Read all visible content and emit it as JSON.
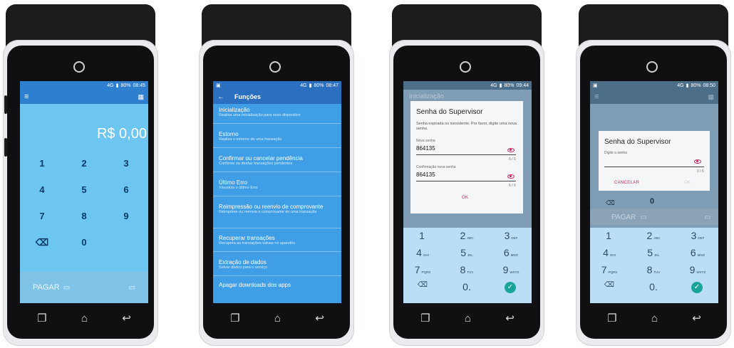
{
  "devices": [
    {
      "status": {
        "network": "4G",
        "battery": "80%",
        "time": "08:45"
      },
      "screen": {
        "amount": "R$ 0,00",
        "keys": [
          "1",
          "2",
          "3",
          "4",
          "5",
          "6",
          "7",
          "8",
          "9",
          "0"
        ],
        "pay_label": "PAGAR"
      }
    },
    {
      "status": {
        "network": "4G",
        "battery": "80%",
        "time": "08:47"
      },
      "screen": {
        "title": "Funções",
        "menu": [
          {
            "title": "Inicialização",
            "desc": "Realiza uma inicialização para esse dispositivo"
          },
          {
            "title": "Estorno",
            "desc": "Realiza o estorno de uma transação"
          },
          {
            "title": "Confirmar ou cancelar pendência",
            "desc": "Confirme ou desfaz transações pendentes"
          },
          {
            "title": "Último Erro",
            "desc": "Visualiza o último Erro"
          },
          {
            "title": "Reimpressão ou reenvio de comprovante",
            "desc": "Reimprime ou reenvia o comprovante de uma transação"
          },
          {
            "title": "Recuperar transações",
            "desc": "Recupera as transações salvas no aparelho"
          },
          {
            "title": "Extração de dados",
            "desc": "Salvar dados para o serviço"
          },
          {
            "title": "Apagar downloads dos apps",
            "desc": ""
          }
        ]
      }
    },
    {
      "status": {
        "network": "4G",
        "battery": "80%",
        "time": "09:44"
      },
      "screen": {
        "background_title": "Inicialização",
        "dialog": {
          "title": "Senha do Supervisor",
          "message": "Senha expirada ou inexistente. Por favor, digite uma nova senha.",
          "field1_label": "Nova senha",
          "field1_value": "864135",
          "field1_count": "6 / 6",
          "field2_label": "Confirmação nova senha",
          "field2_value": "864135",
          "field2_count": "6 / 6",
          "ok_label": "OK"
        },
        "keys": [
          {
            "digit": "1",
            "letters": ""
          },
          {
            "digit": "2",
            "letters": "ABC"
          },
          {
            "digit": "3",
            "letters": "DEF"
          },
          {
            "digit": "4",
            "letters": "GHI"
          },
          {
            "digit": "5",
            "letters": "JKL"
          },
          {
            "digit": "6",
            "letters": "MNO"
          },
          {
            "digit": "7",
            "letters": "PQRS"
          },
          {
            "digit": "8",
            "letters": "TUV"
          },
          {
            "digit": "9",
            "letters": "WXYZ"
          }
        ],
        "zero": "0",
        "dot": "."
      }
    },
    {
      "status": {
        "network": "4G",
        "battery": "80%",
        "time": "08:50"
      },
      "screen": {
        "dialog": {
          "title": "Senha do Supervisor",
          "field_label": "Digite a senha",
          "field_count": "0 / 6",
          "cancel_label": "CANCELAR",
          "ok_label": "OK"
        },
        "bg_zero": "0",
        "pay_label": "PAGAR",
        "keys": [
          {
            "digit": "1",
            "letters": ""
          },
          {
            "digit": "2",
            "letters": "ABC"
          },
          {
            "digit": "3",
            "letters": "DEF"
          },
          {
            "digit": "4",
            "letters": "GHI"
          },
          {
            "digit": "5",
            "letters": "JKL"
          },
          {
            "digit": "6",
            "letters": "MNO"
          },
          {
            "digit": "7",
            "letters": "PQRS"
          },
          {
            "digit": "8",
            "letters": "TUV"
          },
          {
            "digit": "9",
            "letters": "WXYZ"
          }
        ],
        "zero": "0",
        "dot": "."
      }
    }
  ],
  "colors": {
    "appbar": "#2f7fd0",
    "screen_bg": "#6cc6f0",
    "accent": "#d2245a",
    "confirm": "#1aa39a"
  }
}
